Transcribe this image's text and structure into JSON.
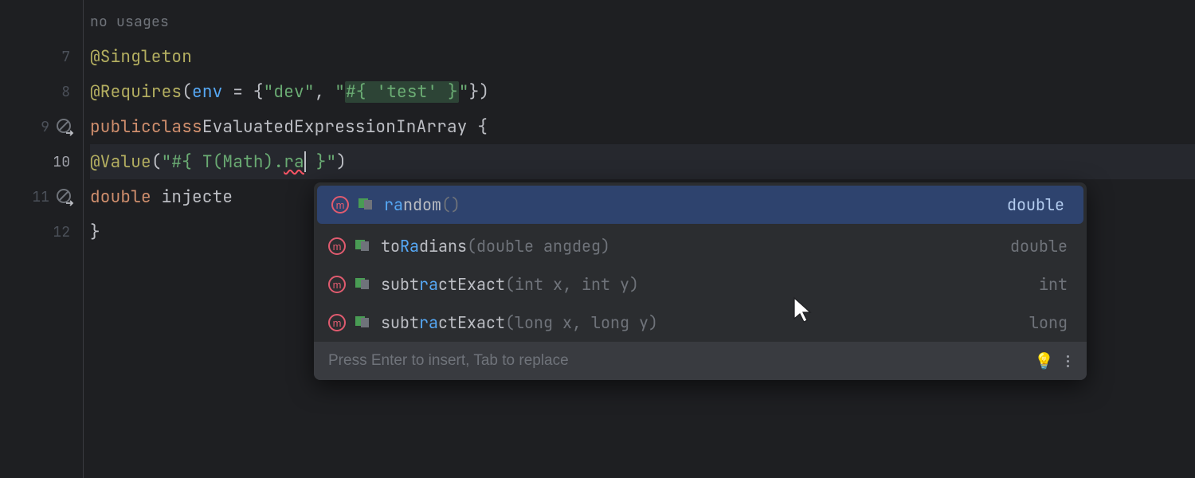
{
  "gutter": {
    "lines": [
      "",
      "7",
      "8",
      "9",
      "10",
      "11",
      "12"
    ],
    "current_line": "10"
  },
  "usages_hint": "no usages",
  "code": {
    "l7_ann": "@Singleton",
    "l8_ann": "@Requires",
    "l8_param": "env",
    "l8_op": " = {",
    "l8_s1": "\"dev\"",
    "l8_sep": ", ",
    "l8_s2a": "\"",
    "l8_s2b": "#{ 'test' }",
    "l8_s2c": "\"",
    "l8_close": "})",
    "l9_kw1": "public",
    "l9_kw2": "class",
    "l9_cls": "EvaluatedExpressionInArray",
    "l9_brace": " {",
    "l10_ann": "@Value",
    "l10_s1": "\"#{ T(Math).",
    "l10_typed": "ra",
    "l10_s2": " }\"",
    "l10_close": ")",
    "l11_kw": "double",
    "l11_var": " injecte",
    "l12_brace": "}"
  },
  "completion": {
    "items": [
      {
        "pre": "",
        "match": "ra",
        "post": "ndom",
        "sig": "()",
        "ret": "double",
        "selected": true
      },
      {
        "pre": "to",
        "match": "Ra",
        "post": "dians",
        "sig": "(double angdeg)",
        "ret": "double",
        "selected": false
      },
      {
        "pre": "subt",
        "match": "ra",
        "post": "ctExact",
        "sig": "(int x, int y)",
        "ret": "int",
        "selected": false
      },
      {
        "pre": "subt",
        "match": "ra",
        "post": "ctExact",
        "sig": "(long x, long y)",
        "ret": "long",
        "selected": false
      }
    ],
    "footer_hint": "Press Enter to insert, Tab to replace"
  }
}
